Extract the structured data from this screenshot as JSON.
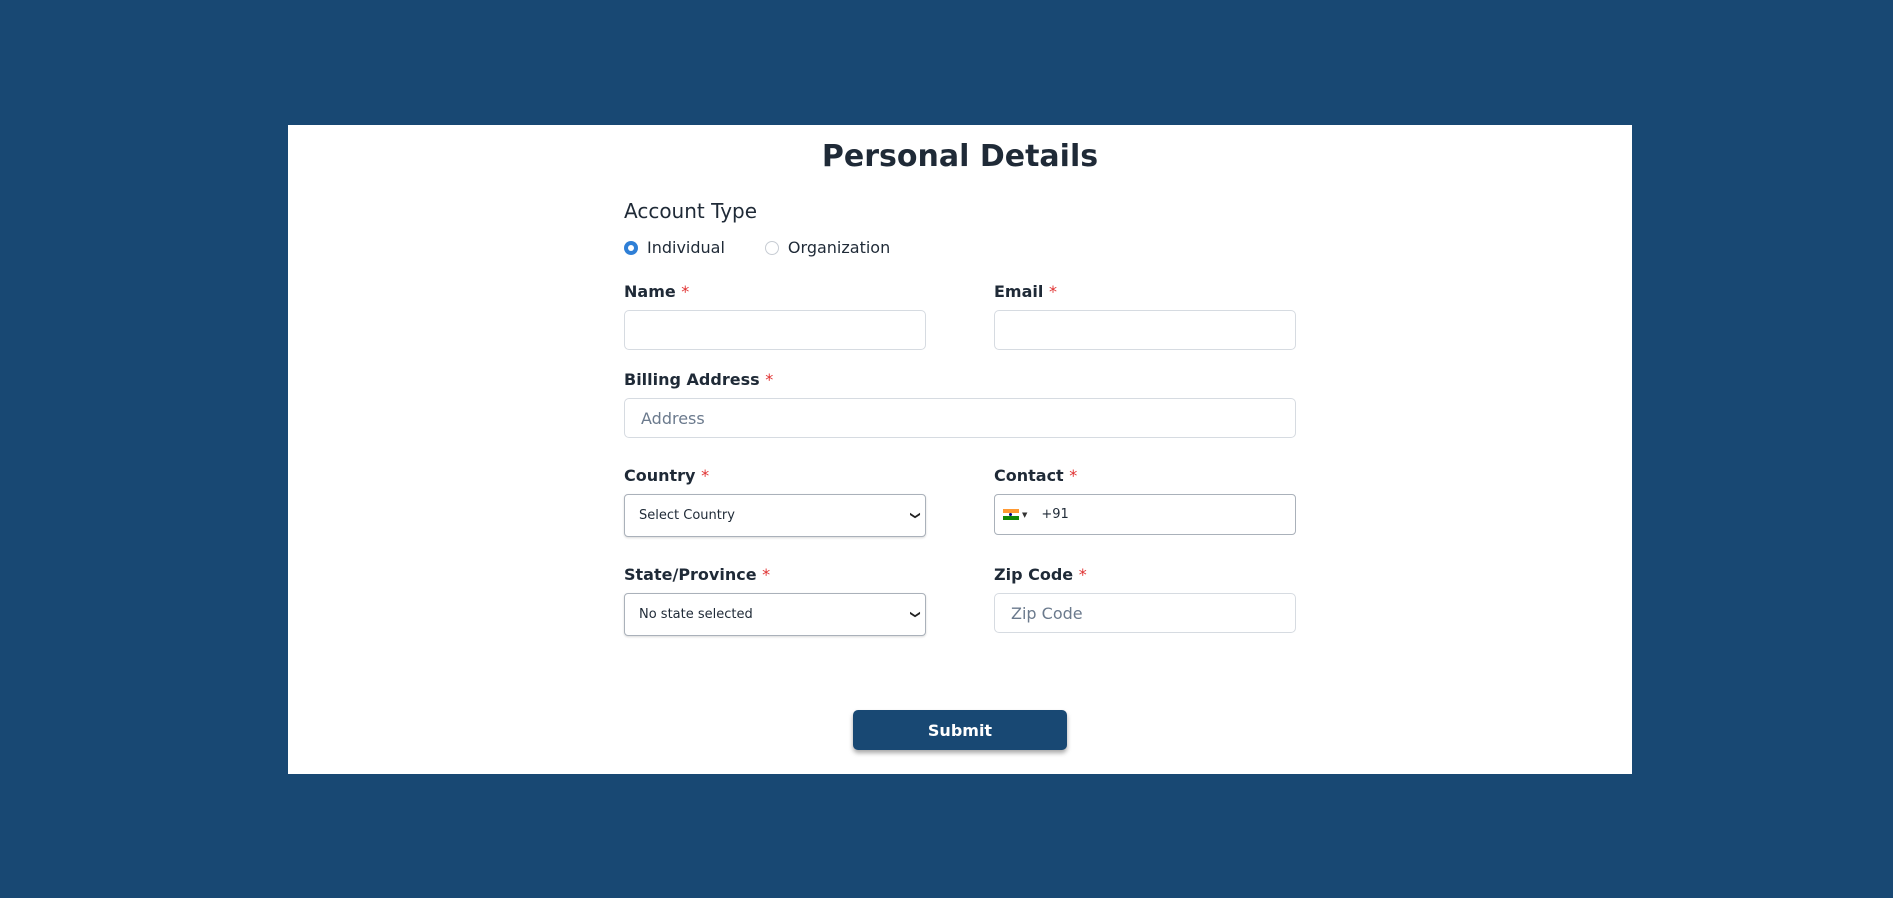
{
  "page": {
    "title": "Personal Details"
  },
  "account_type": {
    "label": "Account Type",
    "options": [
      {
        "label": "Individual",
        "checked": true
      },
      {
        "label": "Organization",
        "checked": false
      }
    ]
  },
  "fields": {
    "name": {
      "label": "Name",
      "required": "*",
      "value": ""
    },
    "email": {
      "label": "Email",
      "required": "*",
      "value": ""
    },
    "billing_address": {
      "label": "Billing Address",
      "required": "*",
      "placeholder": "Address",
      "value": ""
    },
    "country": {
      "label": "Country",
      "required": "*",
      "selected": "Select Country"
    },
    "contact": {
      "label": "Contact",
      "required": "*",
      "country_flag": "india-flag",
      "value": "+91"
    },
    "state": {
      "label": "State/Province",
      "required": "*",
      "selected": "No state selected"
    },
    "zip": {
      "label": "Zip Code",
      "required": "*",
      "placeholder": "Zip Code",
      "value": ""
    }
  },
  "submit": {
    "label": "Submit"
  },
  "colors": {
    "background": "#184873",
    "button": "#184873",
    "radio_accent": "#2f7fd6",
    "required": "#e03131"
  }
}
